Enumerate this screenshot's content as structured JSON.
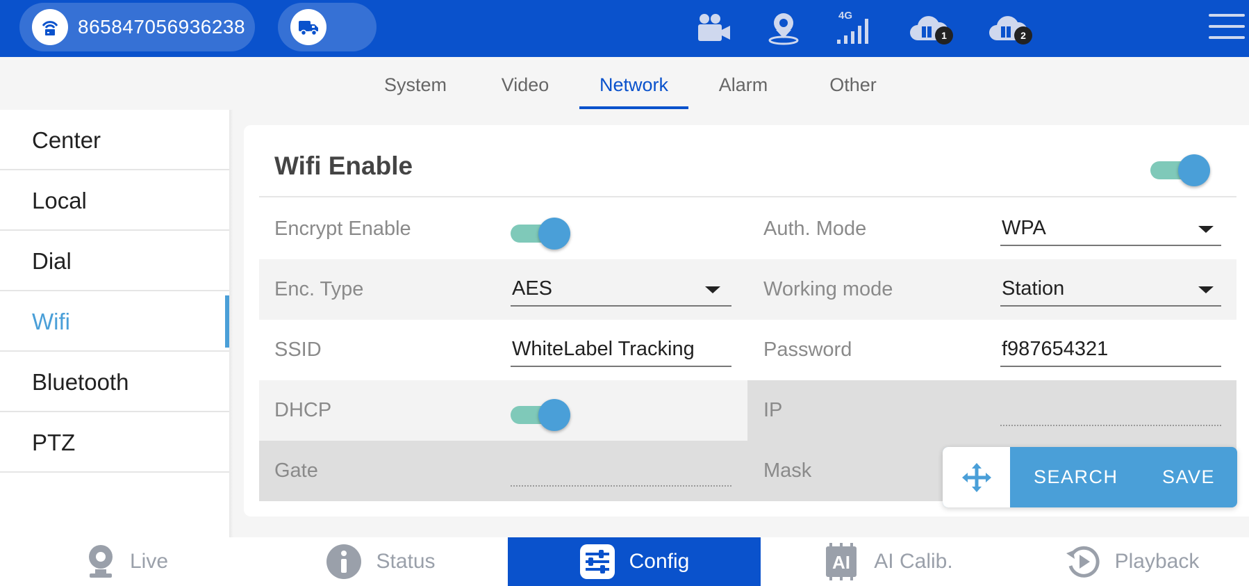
{
  "header": {
    "device_id": "865847056936238",
    "icons": [
      "router-lock-icon",
      "truck-icon",
      "video-camera-icon",
      "location-pin-icon",
      "signal-4g-icon",
      "cloud-server-1-icon",
      "cloud-server-2-icon",
      "menu-icon"
    ],
    "signal_label": "4G",
    "cloud1_badge": "1",
    "cloud2_badge": "2"
  },
  "tabs": [
    {
      "label": "System"
    },
    {
      "label": "Video"
    },
    {
      "label": "Network",
      "active": true
    },
    {
      "label": "Alarm"
    },
    {
      "label": "Other"
    }
  ],
  "sidebar": {
    "items": [
      {
        "label": "Center"
      },
      {
        "label": "Local"
      },
      {
        "label": "Dial"
      },
      {
        "label": "Wifi",
        "active": true
      },
      {
        "label": "Bluetooth"
      },
      {
        "label": "PTZ"
      }
    ]
  },
  "wifi": {
    "title": "Wifi Enable",
    "enabled": true,
    "encrypt_label": "Encrypt Enable",
    "encrypt_enabled": true,
    "auth_label": "Auth. Mode",
    "auth_value": "WPA",
    "enc_type_label": "Enc. Type",
    "enc_type_value": "AES",
    "working_mode_label": "Working mode",
    "working_mode_value": "Station",
    "ssid_label": "SSID",
    "ssid_value": "WhiteLabel Tracking",
    "password_label": "Password",
    "password_value": "f987654321",
    "dhcp_label": "DHCP",
    "dhcp_enabled": true,
    "ip_label": "IP",
    "ip_value": "",
    "gate_label": "Gate",
    "gate_value": "",
    "mask_label": "Mask"
  },
  "toolbar": {
    "search_label": "SEARCH",
    "save_label": "SAVE"
  },
  "bottom_nav": [
    {
      "label": "Live",
      "icon": "webcam-icon"
    },
    {
      "label": "Status",
      "icon": "info-icon"
    },
    {
      "label": "Config",
      "icon": "sliders-icon",
      "active": true
    },
    {
      "label": "AI Calib.",
      "icon": "ai-chip-icon"
    },
    {
      "label": "Playback",
      "icon": "replay-icon"
    }
  ],
  "colors": {
    "primary": "#0a52cc",
    "accent": "#4a9fd8",
    "toggle_track": "#7fc9b9"
  }
}
